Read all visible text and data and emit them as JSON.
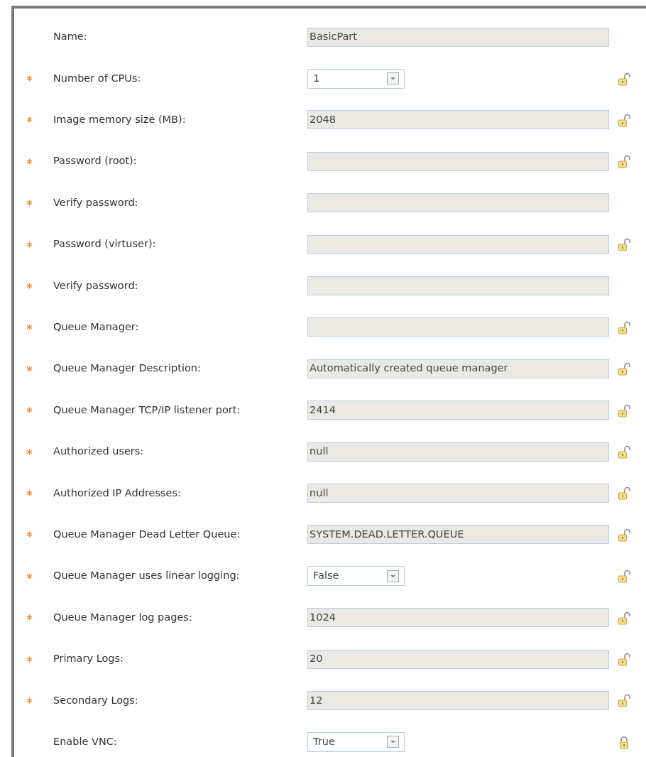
{
  "fields": [
    {
      "label": "Name:",
      "required": false,
      "kind": "text",
      "value": "BasicPart",
      "lock_shown": false
    },
    {
      "label": "Number of CPUs:",
      "required": true,
      "kind": "select",
      "value": "1",
      "lock_shown": true,
      "locked": false
    },
    {
      "label": "Image memory size (MB):",
      "required": true,
      "kind": "text",
      "value": "2048",
      "lock_shown": true,
      "locked": false
    },
    {
      "label": "Password (root):",
      "required": true,
      "kind": "text",
      "lock_shown": true,
      "locked": false
    },
    {
      "label": "Verify password:",
      "required": true,
      "kind": "text",
      "lock_shown": false
    },
    {
      "label": "Password (virtuser):",
      "required": true,
      "kind": "text",
      "lock_shown": true,
      "locked": false
    },
    {
      "label": "Verify password:",
      "required": true,
      "kind": "text",
      "lock_shown": false
    },
    {
      "label": "Queue Manager:",
      "required": true,
      "kind": "text",
      "lock_shown": true,
      "locked": false
    },
    {
      "label": "Queue Manager Description:",
      "required": true,
      "kind": "text",
      "value": "Automatically created queue manager",
      "lock_shown": true,
      "locked": false
    },
    {
      "label": "Queue Manager TCP/IP listener port:",
      "required": true,
      "kind": "text",
      "value": "2414",
      "lock_shown": true,
      "locked": false
    },
    {
      "label": "Authorized users:",
      "required": true,
      "kind": "text",
      "value": "null",
      "lock_shown": true,
      "locked": false
    },
    {
      "label": "Authorized IP Addresses:",
      "required": true,
      "kind": "text",
      "value": "null",
      "lock_shown": true,
      "locked": false
    },
    {
      "label": "Queue Manager Dead Letter Queue:",
      "required": true,
      "kind": "text",
      "value": "SYSTEM.DEAD.LETTER.QUEUE",
      "lock_shown": true,
      "locked": false
    },
    {
      "label": "Queue Manager uses linear logging:",
      "required": true,
      "kind": "select",
      "value": "False",
      "lock_shown": true,
      "locked": false
    },
    {
      "label": "Queue Manager log pages:",
      "required": true,
      "kind": "text",
      "value": "1024",
      "lock_shown": true,
      "locked": false
    },
    {
      "label": "Primary Logs:",
      "required": true,
      "kind": "text",
      "value": "20",
      "lock_shown": true,
      "locked": false
    },
    {
      "label": "Secondary Logs:",
      "required": true,
      "kind": "text",
      "value": "12",
      "lock_shown": true,
      "locked": false
    },
    {
      "label": "Enable VNC:",
      "required": false,
      "kind": "select",
      "value": "True",
      "lock_shown": true,
      "locked": true
    }
  ]
}
